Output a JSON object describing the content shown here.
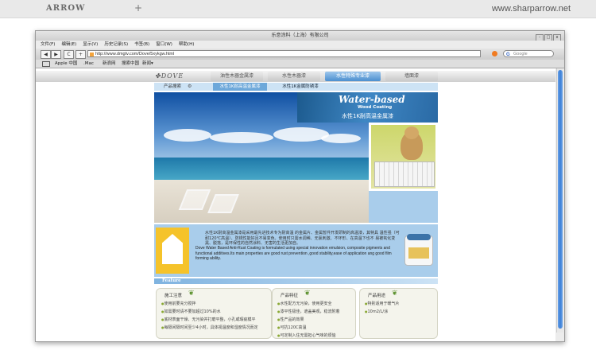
{
  "page": {
    "brand": "ARROW",
    "plus": "+",
    "site": "www.sharparrow.net"
  },
  "browser": {
    "title": "乐意涂料（上海）有限公司",
    "window_controls": [
      "-",
      "□",
      "x"
    ],
    "menu": [
      "文件(F)",
      "编辑(E)",
      "显示(V)",
      "历史记录(S)",
      "书签(B)",
      "窗口(W)",
      "帮助(H)"
    ],
    "nav_buttons": [
      "◀",
      "▶",
      "C",
      "+"
    ],
    "url": "http://www.dmgtv.com/Dove/5xykgw.html",
    "search_placeholder": "Google",
    "search_logo": "G",
    "bookmarks": [
      "Apple 中国",
      ".Mac",
      "新浪网",
      "搜索中国",
      "新闻▾"
    ]
  },
  "site": {
    "logo": "DOVE",
    "nav_tabs": [
      "油性木器金属漆",
      "水性木器漆",
      "水性特殊专业漆",
      "墙面漆"
    ],
    "active_tab_index": 2,
    "sub_label": "产品搜索",
    "sub_tabs": [
      "水性1K耐高温金属漆",
      "水性1K金属防锈漆"
    ],
    "active_sub_index": 0,
    "banner": {
      "title": "Water-based",
      "subtitle": "Wood Coating",
      "cn": "水性1K耐高温金属漆"
    },
    "feature_text_cn": "水性1K耐高温金属漆是采用最先进技术专为耐高温 的金属片、金属暂件开发研制的高温漆，其特具 温性强（可耐120℃高温）、防锈性能好且不易变色、使用时只需水调稀、无氯刺激、不环形、在高温下也不 易被氧化变黑、脱落，是环保性的自然涂料、无害的生活更加自。",
    "feature_text_en": "Dove Water Based Anti-Rust Coating is formulated using special innovation emulsion, composite pigments and functional additives.Its main properties are good rust prevention ,good stability,ease of application ang good film forming ability.",
    "feature_bar": "Feature",
    "panels": [
      {
        "title": "施工注意",
        "items": [
          "使用前要充分搅拌",
          "如需要时请不要加超过10%的水",
          "底材表面干燥、无污染并打磨平整，小孔或瑕疵模平",
          "每隔间隔时间至少4小时，具体视温度和湿度情况而定"
        ]
      },
      {
        "title": "产品特征",
        "items": [
          "水性配方无污染，使用更安全",
          "漆平性极佳，遮盖美观，稳流附着",
          "性产品的效果",
          "可抗120C高温",
          "可定制入住无需担心气味的烦恼"
        ]
      },
      {
        "title": "产品用途",
        "items": [
          "特别适用于暖气片",
          "10m2/L/涂"
        ]
      }
    ]
  }
}
